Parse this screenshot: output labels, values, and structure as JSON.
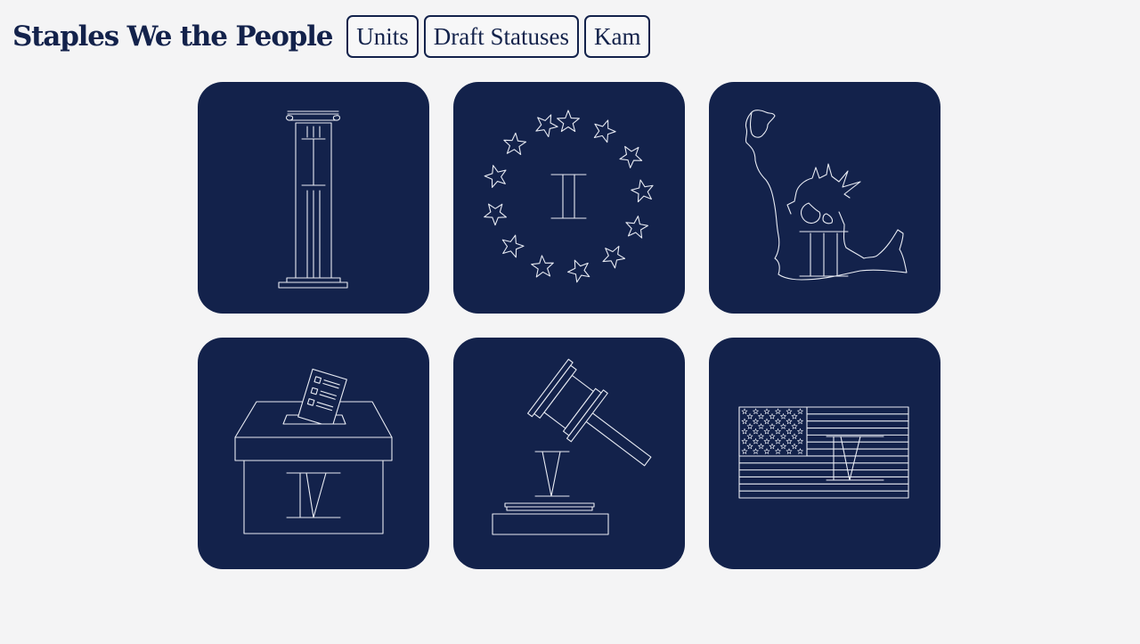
{
  "header": {
    "brand": "Staples We the People",
    "nav": [
      {
        "label": "Units"
      },
      {
        "label": "Draft Statuses"
      },
      {
        "label": "Kam"
      }
    ]
  },
  "cards": [
    {
      "icon": "column-icon",
      "numeral": "I"
    },
    {
      "icon": "star-circle-icon",
      "numeral": "II"
    },
    {
      "icon": "statue-of-liberty-icon",
      "numeral": "III"
    },
    {
      "icon": "ballot-box-icon",
      "numeral": "IV"
    },
    {
      "icon": "gavel-icon",
      "numeral": "V"
    },
    {
      "icon": "us-flag-icon",
      "numeral": "VI"
    }
  ],
  "colors": {
    "background": "#f4f4f5",
    "card": "#13224b",
    "line": "#e8ebf3",
    "text": "#13224b"
  }
}
